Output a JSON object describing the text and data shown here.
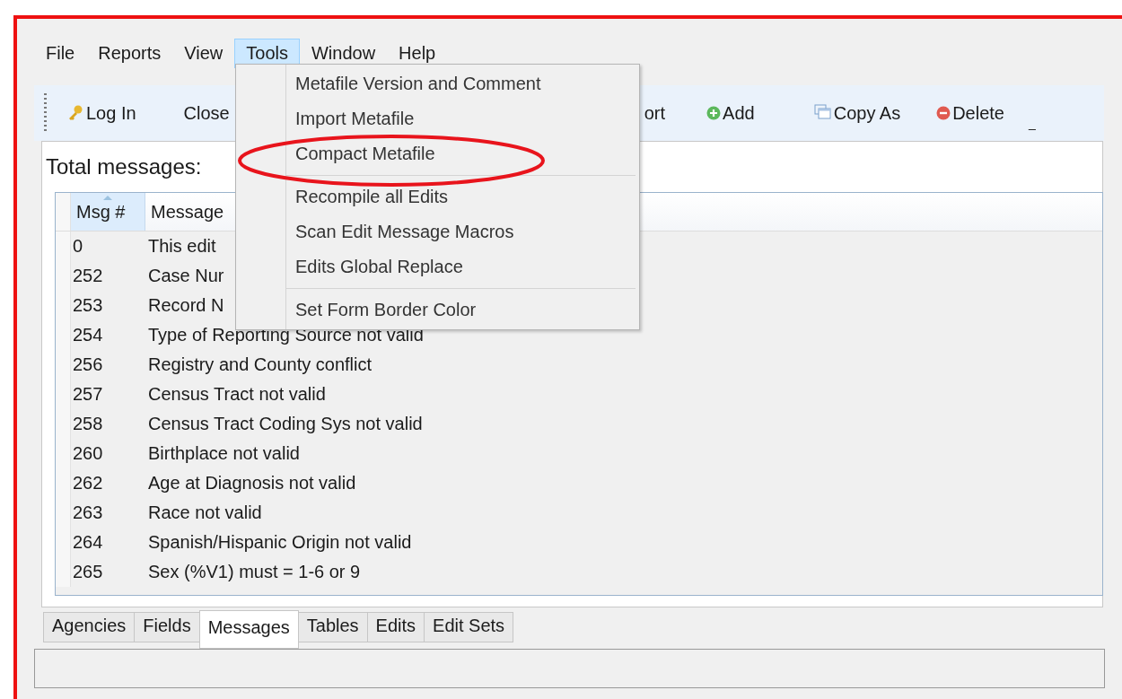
{
  "menu_bar": [
    {
      "label": "File",
      "selected": false
    },
    {
      "label": "Reports",
      "selected": false
    },
    {
      "label": "View",
      "selected": false
    },
    {
      "label": "Tools",
      "selected": true
    },
    {
      "label": "Window",
      "selected": false
    },
    {
      "label": "Help",
      "selected": false
    }
  ],
  "tools_menu": {
    "groups": [
      [
        "Metafile Version and Comment",
        "Import Metafile",
        "Compact Metafile"
      ],
      [
        "Recompile all Edits",
        "Scan Edit Message Macros",
        "Edits Global Replace"
      ],
      [
        "Set Form Border Color"
      ]
    ]
  },
  "toolbar": [
    {
      "kind": "key",
      "label": "Log In"
    },
    {
      "kind": "plain",
      "label": "Close"
    },
    {
      "kind": "plain",
      "label": "ort"
    },
    {
      "kind": "add",
      "label": "Add"
    },
    {
      "kind": "copy",
      "label": "Copy As"
    },
    {
      "kind": "delete",
      "label": "Delete"
    },
    {
      "kind": "plain",
      "label": "_"
    }
  ],
  "total_label": "Total messages:",
  "table": {
    "columns": [
      "Msg #",
      "Message"
    ],
    "rows": [
      [
        "0",
        "This edit"
      ],
      [
        "252",
        "Case Nur"
      ],
      [
        "253",
        "Record N"
      ],
      [
        "254",
        "Type of Reporting Source not valid"
      ],
      [
        "256",
        "Registry and County conflict"
      ],
      [
        "257",
        "Census Tract not valid"
      ],
      [
        "258",
        "Census Tract Coding Sys not valid"
      ],
      [
        "260",
        "Birthplace not valid"
      ],
      [
        "262",
        "Age at Diagnosis not valid"
      ],
      [
        "263",
        "Race not valid"
      ],
      [
        "264",
        "Spanish/Hispanic Origin not valid"
      ],
      [
        "265",
        "Sex (%V1) must = 1-6 or 9"
      ]
    ]
  },
  "tabs": [
    {
      "label": "Agencies",
      "selected": false
    },
    {
      "label": "Fields",
      "selected": false
    },
    {
      "label": "Messages",
      "selected": true
    },
    {
      "label": "Tables",
      "selected": false
    },
    {
      "label": "Edits",
      "selected": false
    },
    {
      "label": "Edit Sets",
      "selected": false
    }
  ],
  "annotation": {
    "kind": "ellipse"
  }
}
